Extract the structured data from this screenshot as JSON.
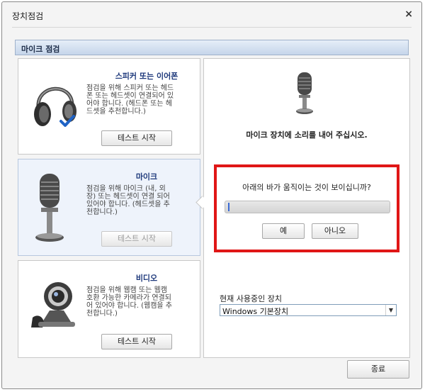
{
  "window": {
    "title": "장치점검",
    "close_glyph": "×"
  },
  "section": {
    "title": "마이크 점검"
  },
  "panels": [
    {
      "title": "스피커 또는 이어폰",
      "desc": [
        "점검을 위해 스피커 또는 헤드",
        "폰 또는 헤드셋이 연결되어 있",
        "어야 합니다. (헤드폰 또는 헤",
        "드셋을 추천합니다.)"
      ],
      "button": "테스트 시작",
      "icon": "headphones-icon"
    },
    {
      "title": "마이크",
      "desc": [
        "점검을 위해 마이크 (내, 외",
        "장) 또는 헤드셋이 연결 되어",
        "있어야 합니다. (헤드셋을 추",
        "천합니다.)"
      ],
      "button": "테스트 시작",
      "icon": "microphone-icon"
    },
    {
      "title": "비디오",
      "desc": [
        "점검을 위해 웹캠 또는 웹캠",
        "호환 가능한 카메라가 연결되",
        "어 있어야 합니다. (웹캠을 추",
        "천합니다.)"
      ],
      "button": "테스트 시작",
      "icon": "webcam-icon"
    }
  ],
  "mic_test": {
    "instruction": "마이크 장치에 소리를 내어 주십시오.",
    "question": "아래의 바가 움직이는 것이 보이십니까?",
    "level": 0,
    "yes_label": "예",
    "no_label": "아니오"
  },
  "device": {
    "label": "현재 사용중인 장치",
    "selected": "Windows 기본장치"
  },
  "footer": {
    "close_label": "종료"
  }
}
